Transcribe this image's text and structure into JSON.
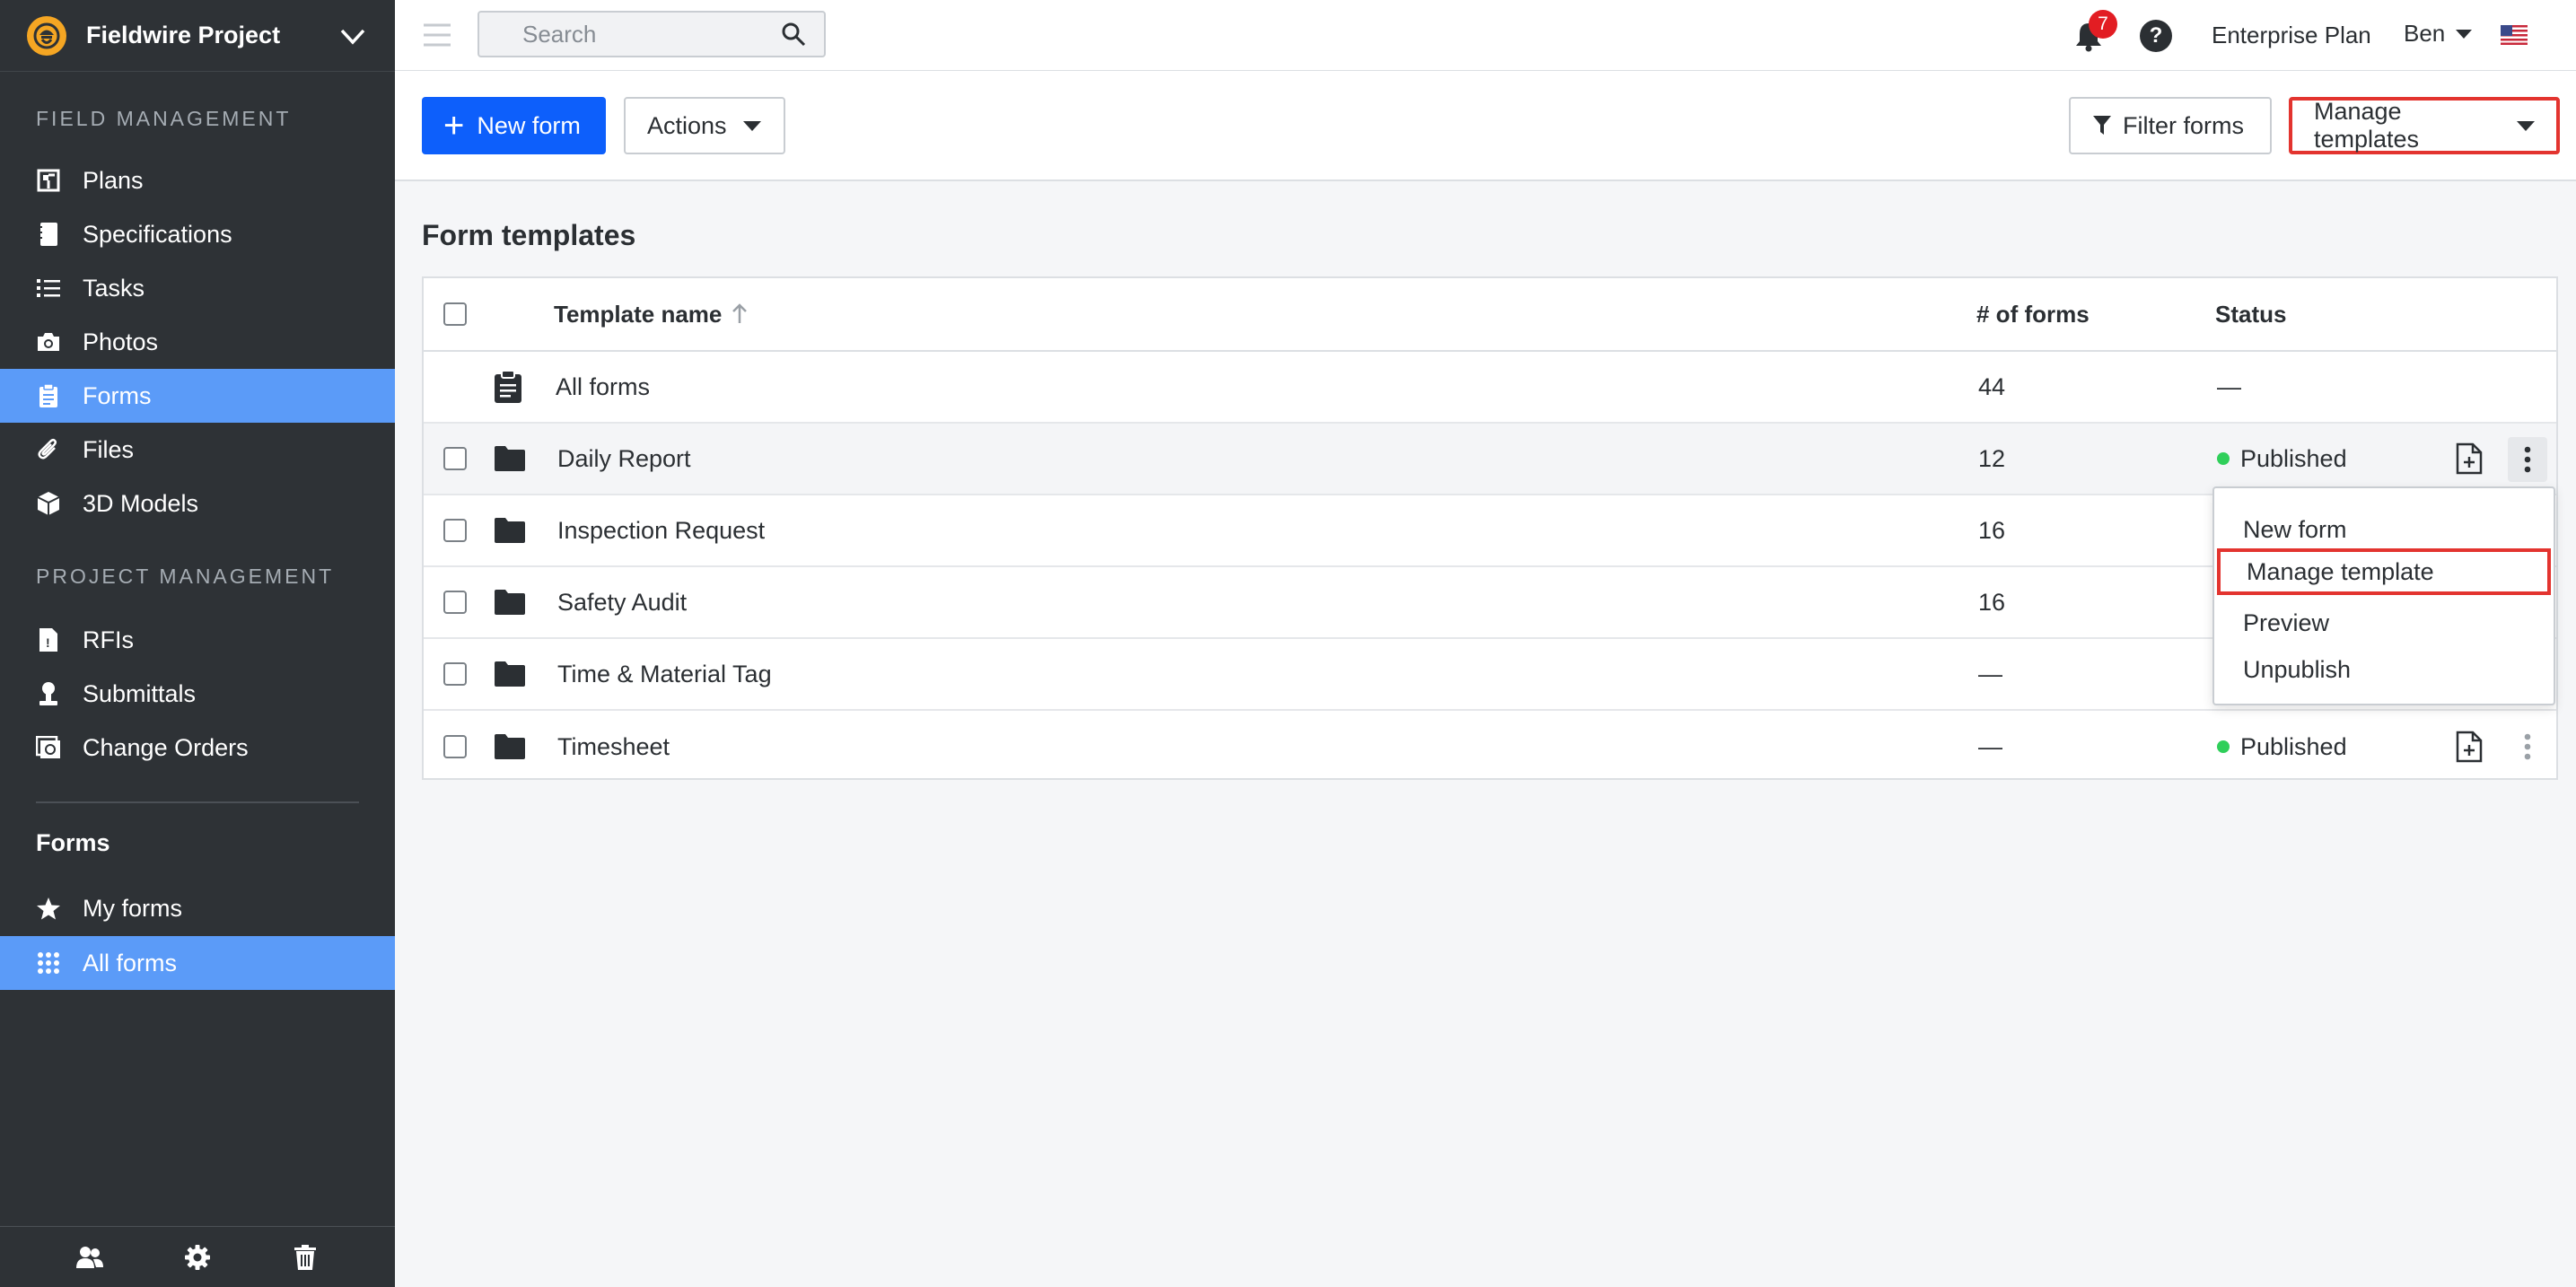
{
  "sidebar": {
    "project_name": "Fieldwire Project",
    "field_section": "FIELD MANAGEMENT",
    "field_items": [
      {
        "label": "Plans",
        "icon": "plans-icon"
      },
      {
        "label": "Specifications",
        "icon": "specifications-icon"
      },
      {
        "label": "Tasks",
        "icon": "tasks-icon"
      },
      {
        "label": "Photos",
        "icon": "camera-icon"
      },
      {
        "label": "Forms",
        "icon": "clipboard-icon",
        "active": true
      },
      {
        "label": "Files",
        "icon": "paperclip-icon"
      },
      {
        "label": "3D Models",
        "icon": "cube-icon"
      }
    ],
    "project_section": "PROJECT MANAGEMENT",
    "project_items": [
      {
        "label": "RFIs",
        "icon": "rfi-icon"
      },
      {
        "label": "Submittals",
        "icon": "submittals-icon"
      },
      {
        "label": "Change Orders",
        "icon": "change-orders-icon"
      }
    ],
    "forms_heading": "Forms",
    "forms_items": [
      {
        "label": "My forms",
        "icon": "star-icon"
      },
      {
        "label": "All forms",
        "icon": "grid-icon",
        "active": true
      }
    ]
  },
  "topbar": {
    "search_placeholder": "Search",
    "notification_count": "7",
    "help_label": "?",
    "plan": "Enterprise Plan",
    "user": "Ben"
  },
  "actionbar": {
    "new_form": "New form",
    "actions": "Actions",
    "filter_forms": "Filter forms",
    "manage_templates": "Manage templates"
  },
  "main": {
    "title": "Form templates",
    "columns": {
      "name": "Template name",
      "count": "# of forms",
      "status": "Status"
    },
    "rows": [
      {
        "name": "All forms",
        "count": "44",
        "status": "—"
      },
      {
        "name": "Daily Report",
        "count": "12",
        "status": "Published"
      },
      {
        "name": "Inspection Request",
        "count": "16",
        "status": ""
      },
      {
        "name": "Safety Audit",
        "count": "16",
        "status": ""
      },
      {
        "name": "Time & Material Tag",
        "count": "—",
        "status": ""
      },
      {
        "name": "Timesheet",
        "count": "—",
        "status": "Published"
      }
    ]
  },
  "row_menu": {
    "items": [
      "New form",
      "Manage template",
      "Preview",
      "Unpublish"
    ]
  },
  "colors": {
    "sidebar_bg": "#2e3236",
    "sidebar_active": "#5b9bf8",
    "primary": "#0d5ffb",
    "highlight": "#e3342f",
    "published": "#2fcf5a"
  }
}
